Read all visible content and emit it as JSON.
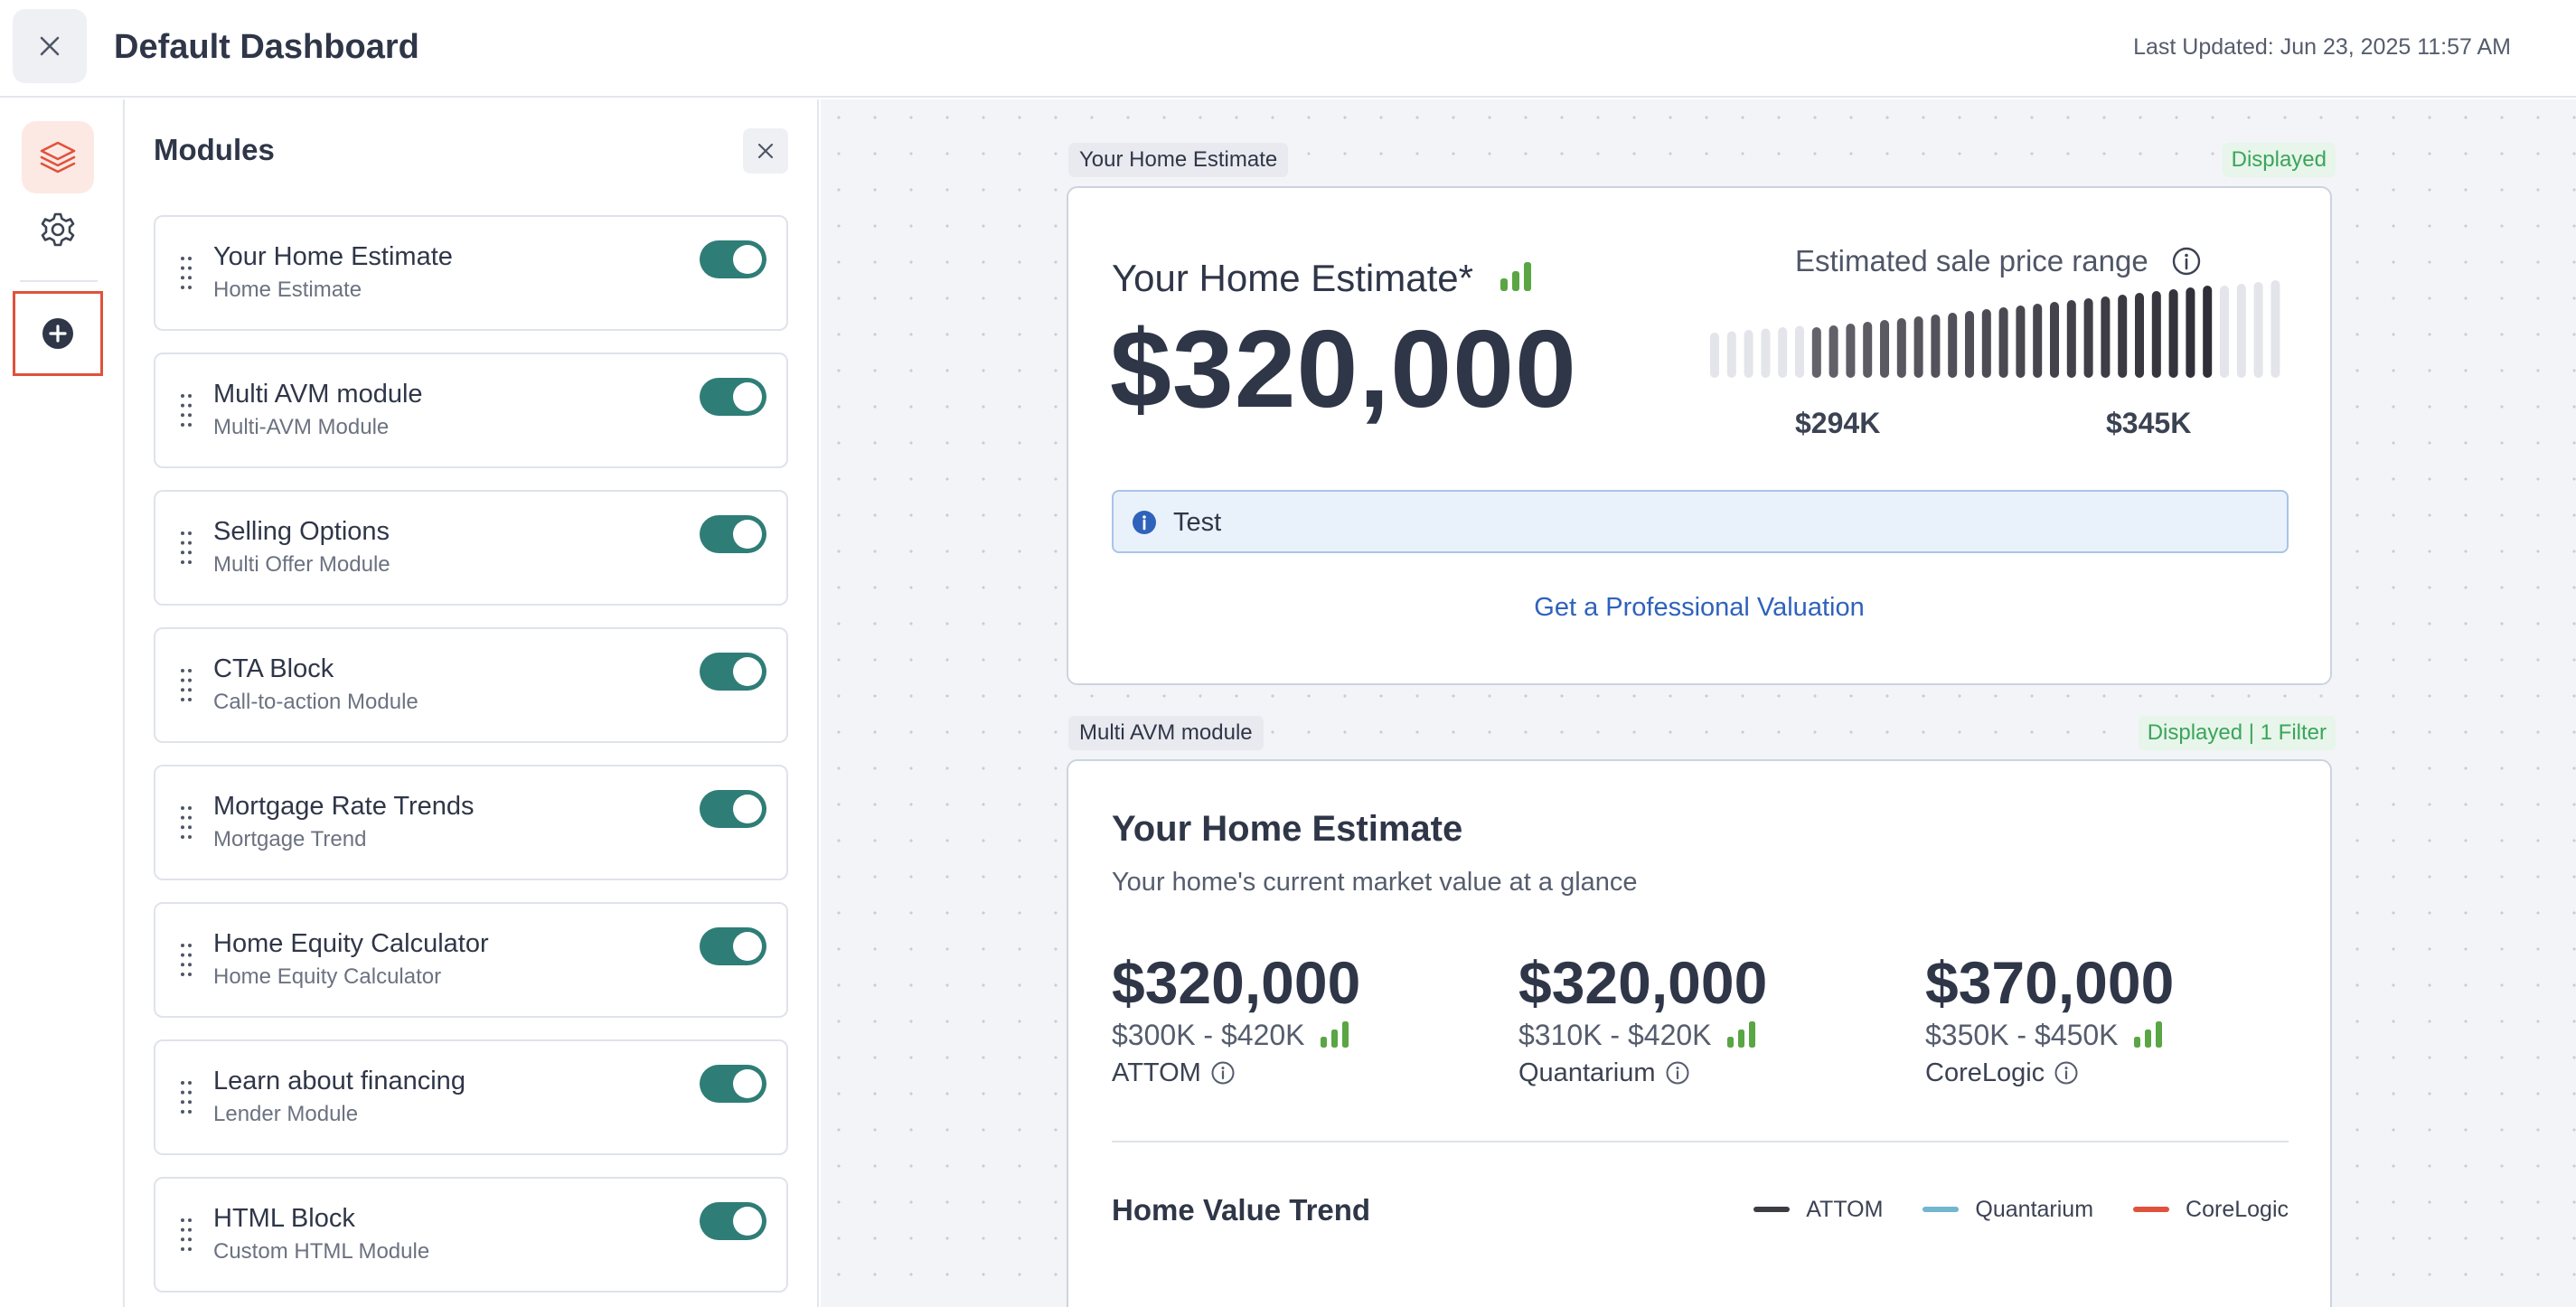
{
  "header": {
    "title": "Default Dashboard",
    "last_updated": "Last Updated: Jun 23, 2025 11:57 AM"
  },
  "rail": {
    "icons": [
      "layers-icon",
      "gear-icon",
      "plus-circle-icon"
    ],
    "colors": {
      "active_bg": "#fde9e4",
      "active_icon": "#e0523c",
      "highlight_border": "#e0523c"
    }
  },
  "modules": {
    "title": "Modules",
    "items": [
      {
        "name": "Your Home Estimate",
        "type": "Home Estimate",
        "enabled": true
      },
      {
        "name": "Multi AVM module",
        "type": "Multi-AVM Module",
        "enabled": true
      },
      {
        "name": "Selling Options",
        "type": "Multi Offer Module",
        "enabled": true
      },
      {
        "name": "CTA Block",
        "type": "Call-to-action Module",
        "enabled": true
      },
      {
        "name": "Mortgage Rate Trends",
        "type": "Mortgage Trend",
        "enabled": true
      },
      {
        "name": "Home Equity Calculator",
        "type": "Home Equity Calculator",
        "enabled": true
      },
      {
        "name": "Learn about financing",
        "type": "Lender Module",
        "enabled": true
      },
      {
        "name": "HTML Block",
        "type": "Custom HTML Module",
        "enabled": true
      }
    ],
    "toggle_color": "#2f7d77"
  },
  "preview": {
    "estimate_card": {
      "tag": "Your Home Estimate",
      "status": "Displayed",
      "title": "Your Home Estimate*",
      "value": "$320,000",
      "range_label": "Estimated sale price range",
      "range_low": "$294K",
      "range_high": "$345K",
      "alert_text": "Test",
      "cta_label": "Get a Professional Valuation"
    },
    "avm_card": {
      "tag": "Multi AVM module",
      "status": "Displayed | 1 Filter",
      "title": "Your Home Estimate",
      "subtitle": "Your home's current market value at a glance",
      "providers": [
        {
          "value": "$320,000",
          "range": "$300K - $420K",
          "name": "ATTOM"
        },
        {
          "value": "$320,000",
          "range": "$310K - $420K",
          "name": "Quantarium"
        },
        {
          "value": "$370,000",
          "range": "$350K - $450K",
          "name": "CoreLogic"
        }
      ],
      "trend_title": "Home Value Trend",
      "legend": [
        {
          "name": "ATTOM",
          "color": "#3b3d42"
        },
        {
          "name": "Quantarium",
          "color": "#72b6d0"
        },
        {
          "name": "CoreLogic",
          "color": "#e0523c"
        }
      ]
    },
    "colors": {
      "status_green": "#3aa55a",
      "signal_green": "#5aa544",
      "link_blue": "#2f62bb"
    }
  }
}
